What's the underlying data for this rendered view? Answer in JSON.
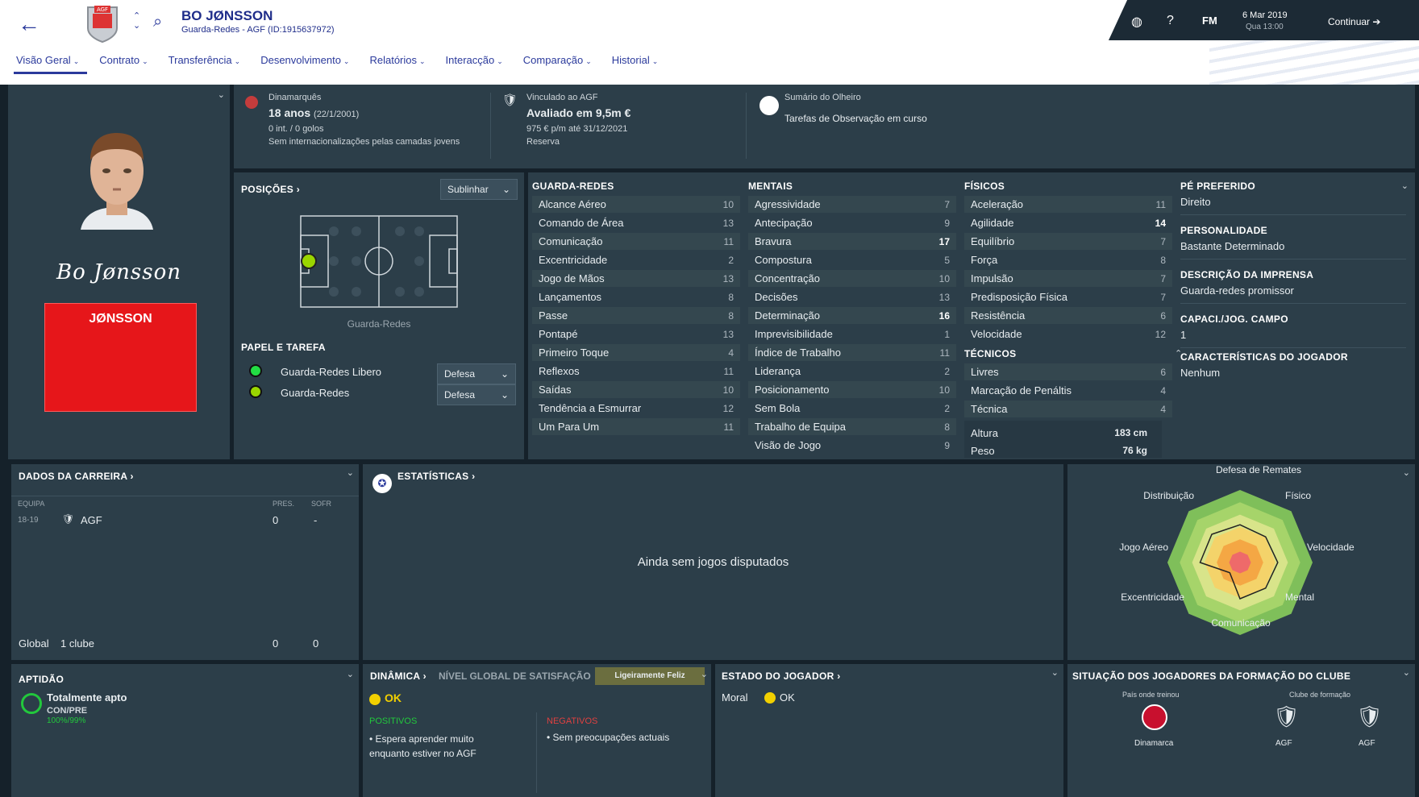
{
  "header": {
    "name": "BO JØNSSON",
    "subtitle": "Guarda-Redes - AGF (ID:1915637972)",
    "date": "6 Mar 2019",
    "day": "Qua 13:00",
    "fm": "FM",
    "continue": "Continuar"
  },
  "tabs": [
    "Visão Geral",
    "Contrato",
    "Transferência",
    "Desenvolvimento",
    "Relatórios",
    "Interacção",
    "Comparação",
    "Historial"
  ],
  "profile": {
    "signature": "Bo Jønsson",
    "shirt_name": "JØNSSON"
  },
  "info": {
    "nationality": "Dinamarquês",
    "age": "18 anos",
    "dob": "(22/1/2001)",
    "caps": "0 int. / 0 golos",
    "youth": "Sem internacionalizações pelas camadas jovens",
    "club_label": "Vinculado ao AGF",
    "value": "Avaliado em 9,5m €",
    "wage": "975 € p/m até 31/12/2021",
    "squad": "Reserva",
    "scout_label": "Sumário do Olheiro",
    "scout_text": "Tarefas de Observação em curso"
  },
  "positions": {
    "title": "POSIÇÕES",
    "highlight": "Sublinhar",
    "pos_label": "Guarda-Redes",
    "role_title": "PAPEL E TAREFA",
    "roles": [
      {
        "name": "Guarda-Redes Libero",
        "duty": "Defesa"
      },
      {
        "name": "Guarda-Redes",
        "duty": "Defesa"
      }
    ]
  },
  "attrs": {
    "gk_title": "GUARDA-REDES",
    "gk": [
      [
        "Alcance Aéreo",
        "10"
      ],
      [
        "Comando de Área",
        "13"
      ],
      [
        "Comunicação",
        "11"
      ],
      [
        "Excentricidade",
        "2"
      ],
      [
        "Jogo de Mãos",
        "13"
      ],
      [
        "Lançamentos",
        "8"
      ],
      [
        "Passe",
        "8"
      ],
      [
        "Pontapé",
        "13"
      ],
      [
        "Primeiro Toque",
        "4"
      ],
      [
        "Reflexos",
        "11"
      ],
      [
        "Saídas",
        "10"
      ],
      [
        "Tendência a Esmurrar",
        "12"
      ],
      [
        "Um Para Um",
        "11"
      ]
    ],
    "mental_title": "MENTAIS",
    "mental": [
      [
        "Agressividade",
        "7"
      ],
      [
        "Antecipação",
        "9"
      ],
      [
        "Bravura",
        "17"
      ],
      [
        "Compostura",
        "5"
      ],
      [
        "Concentração",
        "10"
      ],
      [
        "Decisões",
        "13"
      ],
      [
        "Determinação",
        "16"
      ],
      [
        "Imprevisibilidade",
        "1"
      ],
      [
        "Índice de Trabalho",
        "11"
      ],
      [
        "Liderança",
        "2"
      ],
      [
        "Posicionamento",
        "10"
      ],
      [
        "Sem Bola",
        "2"
      ],
      [
        "Trabalho de Equipa",
        "8"
      ],
      [
        "Visão de Jogo",
        "9"
      ]
    ],
    "phys_title": "FÍSICOS",
    "phys": [
      [
        "Aceleração",
        "11"
      ],
      [
        "Agilidade",
        "14"
      ],
      [
        "Equilíbrio",
        "7"
      ],
      [
        "Força",
        "8"
      ],
      [
        "Impulsão",
        "7"
      ],
      [
        "Predisposição Física",
        "7"
      ],
      [
        "Resistência",
        "6"
      ],
      [
        "Velocidade",
        "12"
      ]
    ],
    "tech_title": "TÉCNICOS",
    "tech": [
      [
        "Livres",
        "6"
      ],
      [
        "Marcação de Penáltis",
        "4"
      ],
      [
        "Técnica",
        "4"
      ]
    ],
    "height_label": "Altura",
    "height": "183 cm",
    "weight_label": "Peso",
    "weight": "76 kg"
  },
  "side": [
    {
      "t": "PÉ PREFERIDO",
      "v": "Direito"
    },
    {
      "t": "PERSONALIDADE",
      "v": "Bastante Determinado"
    },
    {
      "t": "DESCRIÇÃO DA IMPRENSA",
      "v": "Guarda-redes promissor"
    },
    {
      "t": "CAPACI./JOG. CAMPO",
      "v": "1"
    },
    {
      "t": "CARACTERÍSTICAS DO JOGADOR",
      "v": "Nenhum"
    }
  ],
  "career": {
    "title": "DADOS DA CARREIRA",
    "col_team": "EQUIPA",
    "col_apps": "PRES.",
    "col_conc": "SOFR",
    "season": "18-19",
    "team": "AGF",
    "apps": "0",
    "conc": "-",
    "total_label": "Global",
    "clubs": "1 clube",
    "total_apps": "0",
    "total_conc": "0"
  },
  "stats": {
    "title": "ESTATÍSTICAS",
    "empty": "Ainda sem jogos disputados"
  },
  "radar": {
    "labels": [
      "Defesa de Remates",
      "Físico",
      "Velocidade",
      "Mental",
      "Comunicação",
      "Excentricidade",
      "Jogo Aéreo",
      "Distribuição"
    ]
  },
  "fitness": {
    "title": "APTIDÃO",
    "status": "Totalmente apto",
    "label": "CON/PRE",
    "value": "100%/99%"
  },
  "dynamics": {
    "title": "DINÂMICA",
    "sat_label": "NÍVEL GLOBAL DE SATISFAÇÃO",
    "sat": "Ligeiramente Feliz",
    "status": "OK",
    "pos_title": "POSITIVOS",
    "pos": "Espera aprender muito enquanto estiver no AGF",
    "neg_title": "NEGATIVOS",
    "neg": "Sem preocupações actuais"
  },
  "state": {
    "title": "ESTADO DO JOGADOR",
    "morale_label": "Moral",
    "morale": "OK"
  },
  "youth": {
    "title": "SITUAÇÃO DOS JOGADORES DA FORMAÇÃO DO CLUBE",
    "country_label": "País onde treinou",
    "club_label": "Clube de formação",
    "country": "Dinamarca",
    "club1": "AGF",
    "club2": "AGF"
  },
  "colors": {
    "accent": "#2b3a9c",
    "panel": "#2c3e49",
    "good": "#22c83c"
  }
}
